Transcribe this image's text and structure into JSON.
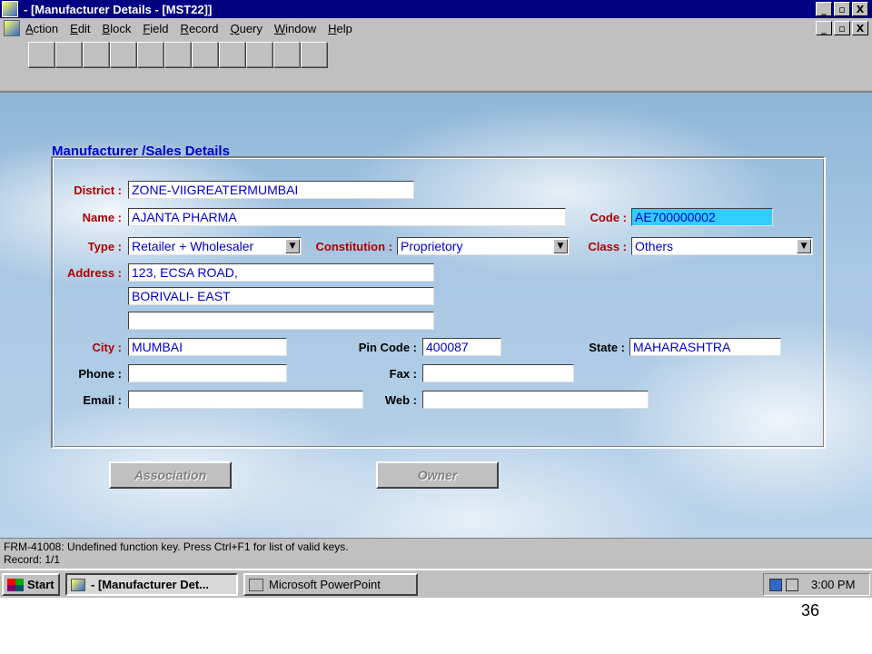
{
  "window": {
    "title": "- [Manufacturer Details - [MST22]]",
    "controls": [
      "_",
      "▫",
      "X"
    ]
  },
  "menu": {
    "items": [
      {
        "label": "Action",
        "key": "A",
        "rest": "ction"
      },
      {
        "label": "Edit",
        "key": "E",
        "rest": "dit"
      },
      {
        "label": "Block",
        "key": "B",
        "rest": "lock"
      },
      {
        "label": "Field",
        "key": "F",
        "rest": "ield"
      },
      {
        "label": "Record",
        "key": "R",
        "rest": "ecord"
      },
      {
        "label": "Query",
        "key": "Q",
        "rest": "uery"
      },
      {
        "label": "Window",
        "key": "W",
        "rest": "indow"
      },
      {
        "label": "Help",
        "key": "H",
        "rest": "elp"
      }
    ]
  },
  "form": {
    "section_title": "Manufacturer /Sales Details",
    "district": {
      "label": "District :",
      "value": "ZONE-VIIGREATERMUMBAI"
    },
    "name": {
      "label": "Name :",
      "value": "AJANTA PHARMA"
    },
    "code": {
      "label": "Code :",
      "value": "AE700000002"
    },
    "type": {
      "label": "Type :",
      "value": "Retailer + Wholesaler"
    },
    "constitution": {
      "label": "Constitution :",
      "value": "Proprietory"
    },
    "class": {
      "label": "Class :",
      "value": "Others"
    },
    "address": {
      "label": "Address :",
      "line1": "123, ECSA ROAD,",
      "line2": "BORIVALI- EAST",
      "line3": ""
    },
    "city": {
      "label": "City :",
      "value": "MUMBAI"
    },
    "pincode": {
      "label": "Pin Code :",
      "value": "400087"
    },
    "state": {
      "label": "State :",
      "value": "MAHARASHTRA"
    },
    "phone": {
      "label": "Phone :",
      "value": ""
    },
    "fax": {
      "label": "Fax :",
      "value": ""
    },
    "email": {
      "label": "Email :",
      "value": ""
    },
    "web": {
      "label": "Web :",
      "value": ""
    }
  },
  "buttons": {
    "association": "Association",
    "owner": "Owner"
  },
  "status": {
    "message": "FRM-41008: Undefined function key.  Press Ctrl+F1  for list of valid keys.",
    "record": "Record: 1/1"
  },
  "taskbar": {
    "start": "Start",
    "task1": "- [Manufacturer Det...",
    "task2": "Microsoft PowerPoint",
    "clock": "3:00 PM"
  },
  "slide_number": "36"
}
